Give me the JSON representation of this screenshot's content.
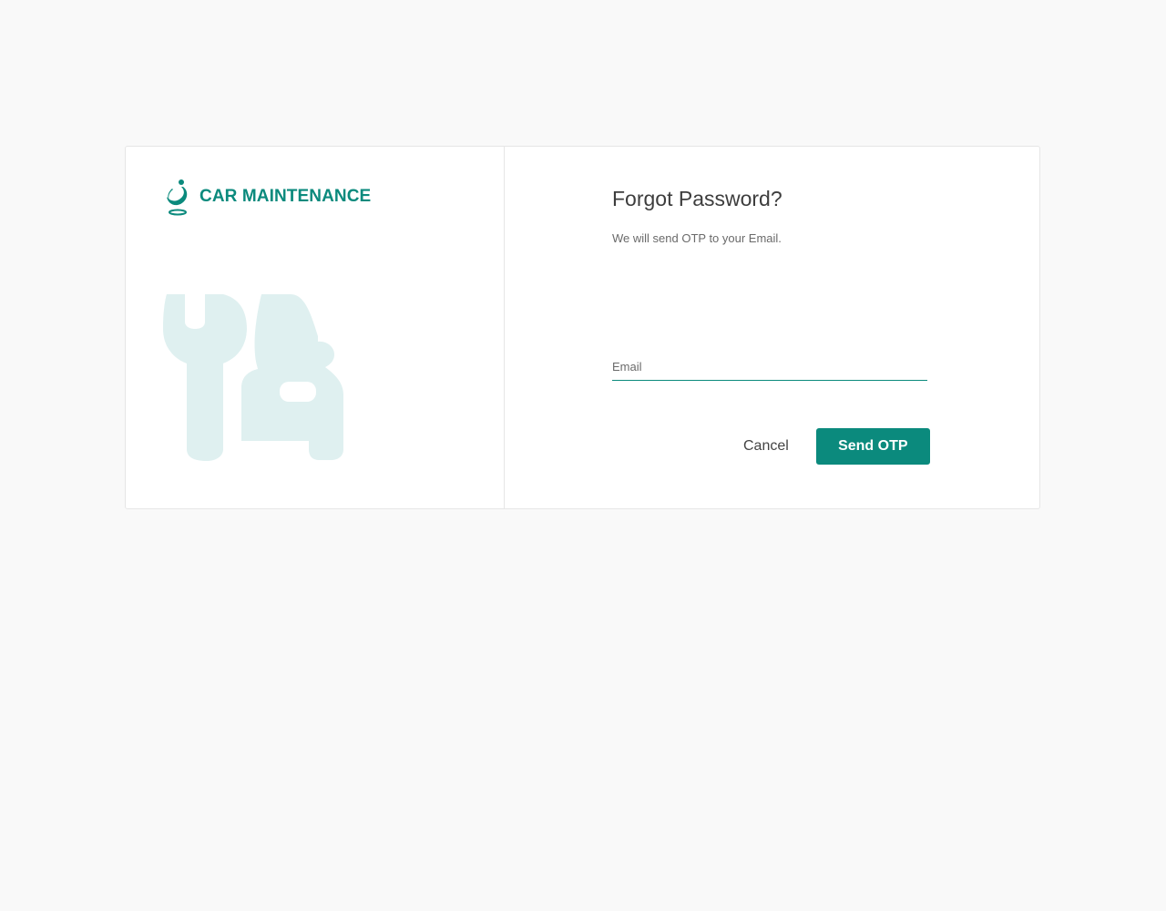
{
  "brand": {
    "name": "CAR MAINTENANCE",
    "logo_icon": "leaf-person-icon",
    "illustration_icon": "car-wrench-icon"
  },
  "form": {
    "title": "Forgot Password?",
    "subtitle": "We will send OTP to your Email.",
    "email": {
      "placeholder": "Email",
      "value": ""
    },
    "cancel_label": "Cancel",
    "submit_label": "Send OTP"
  },
  "colors": {
    "accent": "#0b8a7d",
    "illustration": "#dff0f0",
    "background": "#f9f9f9"
  }
}
